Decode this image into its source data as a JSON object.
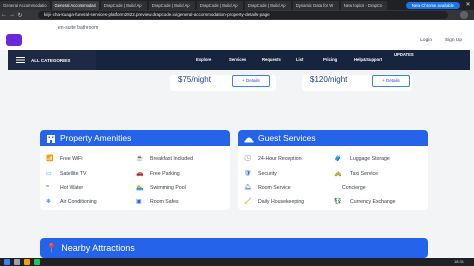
{
  "browser": {
    "tabs": [
      "General Accommodatio",
      "General Accommodati",
      "DrapCode | Build Ap",
      "DrapCode | Build Ap",
      "DrapCode | Build Ap",
      "DrapCode | Build Ap",
      "Dynamic Data for W",
      "New topics - DrapCo"
    ],
    "new_chrome": "New Chrome available",
    "url": "kiijii-cha-kuaga-funeral-services-platform2822.preview.drapcode.io/general-accommodation-property-details-page"
  },
  "site": {
    "suite_text": "en-suite bathroom",
    "login": "Login",
    "signup": "Sign Up",
    "all_categories": "ALL CATEGORIES",
    "menu": [
      "Explore",
      "Services",
      "Requests",
      "List",
      "Pricing",
      "Help&Support",
      "UPDATES"
    ]
  },
  "prices": [
    {
      "price": "$75/night",
      "details": "+ Details"
    },
    {
      "price": "$120/night",
      "details": "+ Details"
    }
  ],
  "amenities": {
    "title": "Property Amenities",
    "left": [
      "Free WiFi",
      "Satellite TV",
      "Hot Water",
      "Air Conditioning"
    ],
    "right": [
      "Breakfast Included",
      "Free Parking",
      "Swimming Pool",
      "Room Safes"
    ]
  },
  "services": {
    "title": "Guest Services",
    "left": [
      "24-Hour Reception",
      "Security",
      "Room Service",
      "Daily Housekeeping"
    ],
    "right": [
      "Luggage Storage",
      "Taxi Service",
      "Concierge",
      "Currency Exchange"
    ]
  },
  "attractions": {
    "title": "Nearby Attractions"
  },
  "taskbar": {
    "time": "18:31"
  }
}
